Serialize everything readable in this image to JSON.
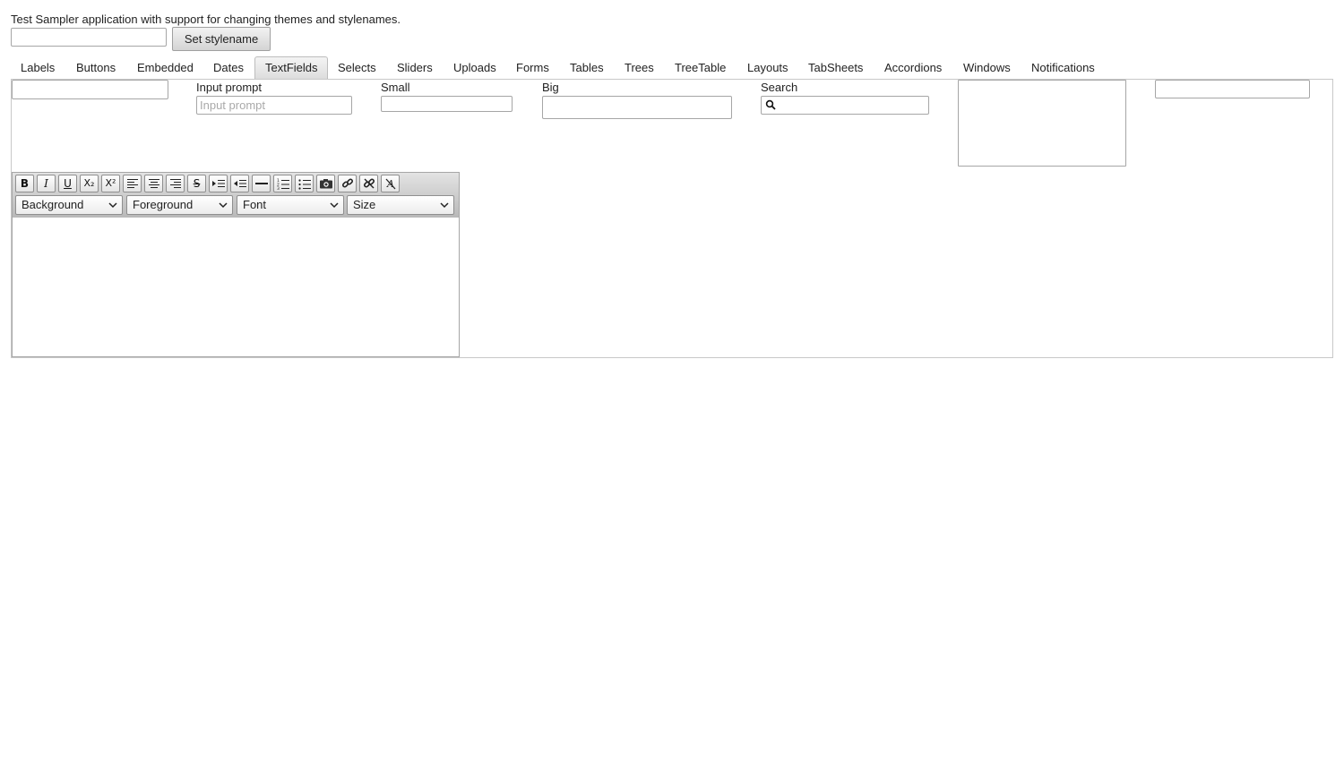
{
  "header": {
    "intro_text": "Test Sampler application with support for changing themes and stylenames.",
    "stylename_input_value": "",
    "set_stylename_label": "Set stylename"
  },
  "tabs": [
    {
      "label": "Labels"
    },
    {
      "label": "Buttons"
    },
    {
      "label": "Embedded"
    },
    {
      "label": "Dates"
    },
    {
      "label": "TextFields",
      "selected": true
    },
    {
      "label": "Selects"
    },
    {
      "label": "Sliders"
    },
    {
      "label": "Uploads"
    },
    {
      "label": "Forms"
    },
    {
      "label": "Tables"
    },
    {
      "label": "Trees"
    },
    {
      "label": "TreeTable"
    },
    {
      "label": "Layouts"
    },
    {
      "label": "TabSheets"
    },
    {
      "label": "Accordions"
    },
    {
      "label": "Windows"
    },
    {
      "label": "Notifications"
    }
  ],
  "textfields": {
    "plain_value": "",
    "input_prompt_caption": "Input prompt",
    "input_prompt_placeholder": "Input prompt",
    "small_caption": "Small",
    "big_caption": "Big",
    "search_caption": "Search",
    "textarea_value": "",
    "right_field_value": ""
  },
  "rich_text": {
    "toolbar_buttons": [
      {
        "name": "bold",
        "glyph": "B"
      },
      {
        "name": "italic",
        "glyph": "I"
      },
      {
        "name": "underline",
        "glyph": "U"
      },
      {
        "name": "subscript",
        "glyph": "X₂"
      },
      {
        "name": "superscript",
        "glyph": "X²"
      },
      {
        "name": "align-left",
        "glyph": ""
      },
      {
        "name": "align-center",
        "glyph": ""
      },
      {
        "name": "align-right",
        "glyph": ""
      },
      {
        "name": "strikethrough",
        "glyph": "S"
      },
      {
        "name": "indent",
        "glyph": ""
      },
      {
        "name": "outdent",
        "glyph": ""
      },
      {
        "name": "horizontal-rule",
        "glyph": ""
      },
      {
        "name": "ordered-list",
        "glyph": ""
      },
      {
        "name": "unordered-list",
        "glyph": ""
      },
      {
        "name": "insert-image",
        "glyph": ""
      },
      {
        "name": "create-link",
        "glyph": ""
      },
      {
        "name": "remove-link",
        "glyph": ""
      },
      {
        "name": "remove-format",
        "glyph": ""
      }
    ],
    "selects": {
      "background": "Background",
      "foreground": "Foreground",
      "font": "Font",
      "size": "Size"
    },
    "body_text": ""
  }
}
